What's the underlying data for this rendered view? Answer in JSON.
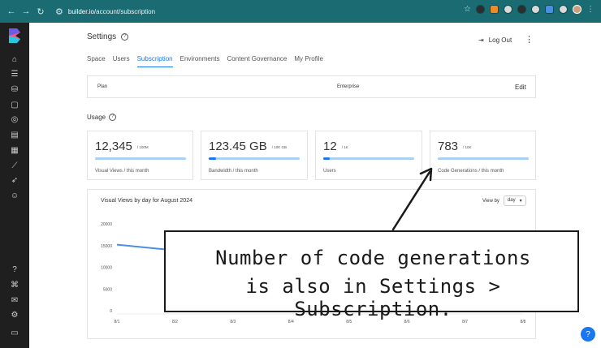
{
  "browser": {
    "url_host": "builder.io",
    "url_path": "/account/subscription"
  },
  "header": {
    "title": "Settings",
    "logout_label": "Log Out"
  },
  "tabs": [
    {
      "label": "Space",
      "active": false
    },
    {
      "label": "Users",
      "active": false
    },
    {
      "label": "Subscription",
      "active": true
    },
    {
      "label": "Environments",
      "active": false
    },
    {
      "label": "Content Governance",
      "active": false
    },
    {
      "label": "My Profile",
      "active": false
    }
  ],
  "plan": {
    "label": "Plan",
    "value": "Enterprise",
    "edit_label": "Edit"
  },
  "usage": {
    "title": "Usage",
    "cards": [
      {
        "value": "12,345",
        "limit": "/ 100M",
        "caption": "Visual Views / this month",
        "fill": 1.0
      },
      {
        "value": "123.45 GB",
        "limit": "/ 10K GB",
        "caption": "Bandwidth / this month",
        "fill": 0.08
      },
      {
        "value": "12",
        "limit": "/ 1K",
        "caption": "Users",
        "fill": 0.07
      },
      {
        "value": "783",
        "limit": "/ 10K",
        "caption": "Code Generations / this month",
        "fill": 1.0
      }
    ]
  },
  "chart": {
    "title": "Visual Views by day for August 2024",
    "viewby_label": "View by",
    "viewby_value": "day"
  },
  "chart_data": {
    "type": "line",
    "title": "Visual Views by day for August 2024",
    "x": [
      "8/1",
      "8/2",
      "8/3",
      "8/4",
      "8/5",
      "8/6",
      "8/7",
      "8/8"
    ],
    "y_ticks": [
      "20000",
      "15000",
      "10000",
      "5000",
      "0"
    ],
    "ylim": [
      0,
      20000
    ],
    "series": [
      {
        "values": [
          15200,
          13900
        ]
      }
    ],
    "grid": false,
    "line_color": "#4a90e2"
  },
  "callout": {
    "line1": "Number of code generations",
    "line2": "is also in Settings > Subscription."
  },
  "colors": {
    "accent": "#1877f2",
    "browser_bar": "#1b6b73",
    "sidebar": "#1f1f1f"
  }
}
